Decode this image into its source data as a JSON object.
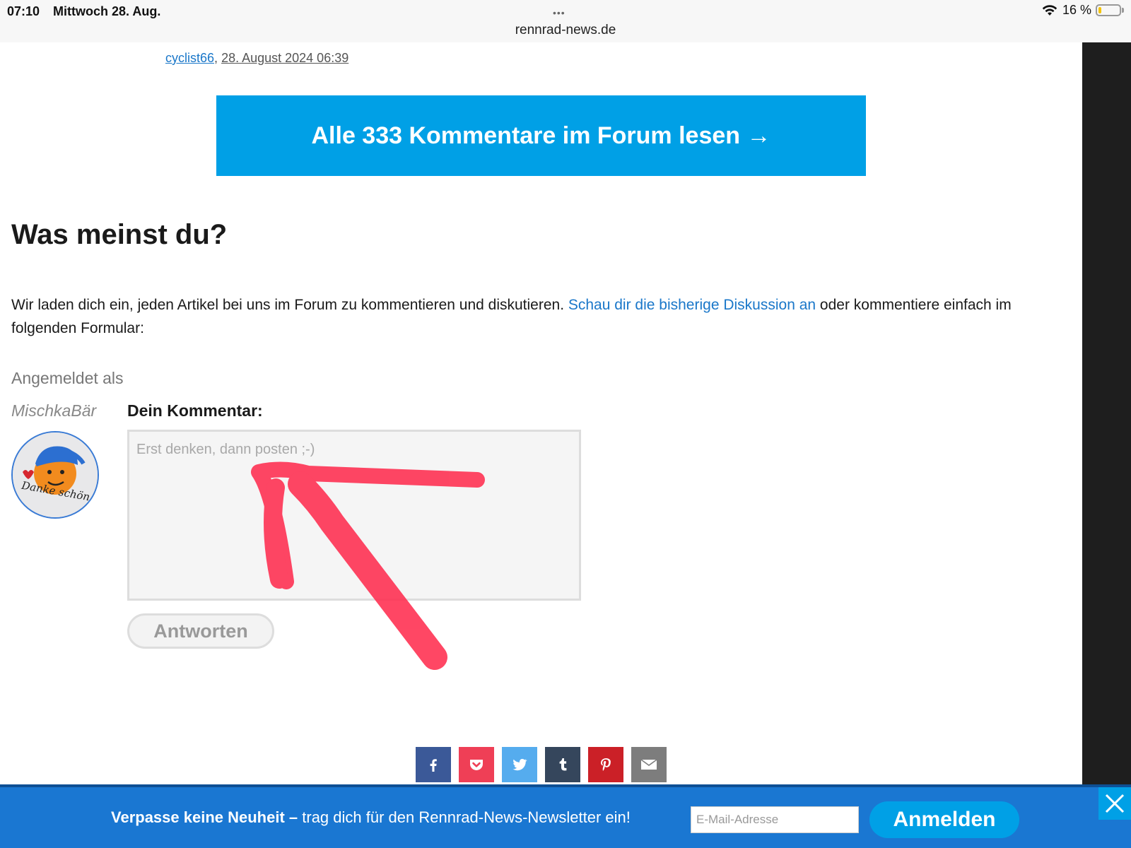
{
  "status_bar": {
    "time": "07:10",
    "date": "Mittwoch 28. Aug.",
    "dots": "•••",
    "domain": "rennrad-news.de",
    "battery": "16 %",
    "battery_level": 0.16,
    "wifi_icon": "wifi-icon"
  },
  "byline": {
    "author": "cyclist66",
    "separator": ",",
    "date": "28. August 2024 06:39"
  },
  "forum_button": {
    "label": "Alle 333 Kommentare im Forum lesen →",
    "color": "#00a0e6"
  },
  "section": {
    "title": "Was meinst du?"
  },
  "intro": {
    "text_before": "Wir laden dich ein, jeden Artikel bei uns im Forum zu kommentieren und diskutieren. ",
    "link": "Schau dir die bisherige Diskussion an",
    "text_after": " oder kommentiere einfach im folgenden Formular:"
  },
  "user": {
    "logged_in_label": "Angemeldet als",
    "username": "MischkaBär",
    "avatar_text": "Danke schön"
  },
  "comment": {
    "label": "Dein Kommentar:",
    "placeholder": "Erst denken, dann posten ;-)",
    "value": "",
    "reply_label": "Antworten"
  },
  "share": [
    {
      "name": "facebook",
      "icon": "facebook-icon",
      "color": "#3b5998"
    },
    {
      "name": "pocket",
      "icon": "pocket-icon",
      "color": "#ef3f56"
    },
    {
      "name": "twitter",
      "icon": "twitter-icon",
      "color": "#55acee"
    },
    {
      "name": "tumblr",
      "icon": "tumblr-icon",
      "color": "#35465c"
    },
    {
      "name": "pinterest",
      "icon": "pinterest-icon",
      "color": "#cb2027"
    },
    {
      "name": "email",
      "icon": "mail-icon",
      "color": "#7d7d7d"
    }
  ],
  "newsletter": {
    "bold": "Verpasse keine Neuheit –",
    "text": " trag dich für den Rennrad-News-Newsletter ein!",
    "placeholder": "E-Mail-Adresse",
    "button": "Anmelden",
    "background": "#1a77d2",
    "button_color": "#00a0e6"
  },
  "colors": {
    "link": "#1a77c9",
    "annotation_arrow": "#ff2d4f"
  }
}
